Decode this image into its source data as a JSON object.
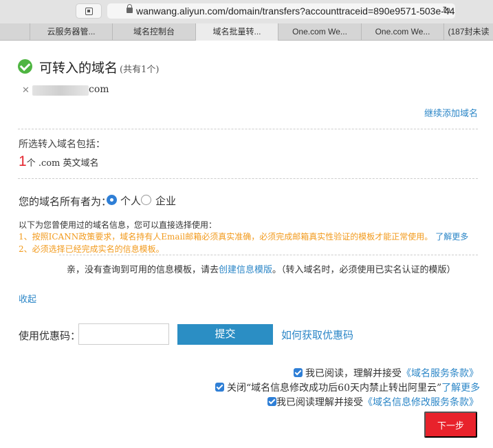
{
  "browser": {
    "url": "wanwang.aliyun.com/domain/transfers?accounttraceid=890e9571-503e-44",
    "tabs": [
      {
        "label": ""
      },
      {
        "label": "云服务器管..."
      },
      {
        "label": "域名控制台"
      },
      {
        "label": "域名批量转..."
      },
      {
        "label": "One.com We..."
      },
      {
        "label": "One.com We..."
      },
      {
        "label": "(187封未读"
      }
    ]
  },
  "section": {
    "title": "可转入的域名",
    "count_text": "(共有1个)",
    "domain_suffix": "com",
    "add_more": "继续添加域名"
  },
  "included": {
    "label": "所选转入域名包括：",
    "count": "1",
    "description": "个 .com 英文域名"
  },
  "owner": {
    "label": "您的域名所有者为：",
    "options": [
      {
        "label": "个人",
        "selected": true
      },
      {
        "label": "企业",
        "selected": false
      }
    ]
  },
  "info": {
    "intro": "以下为您曾使用过的域名信息，您可以直接选择使用：",
    "warning_1": "1、按照ICANN政策要求，域名持有人Email邮箱必须真实准确，必须完成邮箱真实性验证的模板才能正常使用。",
    "learn_more": "了解更多",
    "warning_2": "2、必须选择已经完成实名的信息模板。",
    "no_template_prefix": "亲，没有查询到可用的信息模板，请去",
    "create_template_link": "创建信息模版",
    "no_template_suffix": "。（转入域名时，必须使用已实名认证的模版）",
    "collapse": "收起"
  },
  "coupon": {
    "label": "使用优惠码：",
    "value": "",
    "submit": "提交",
    "help_link": "如何获取优惠码"
  },
  "agreements": {
    "agree1_prefix": "我已阅读，理解并接受",
    "agree1_link": "《域名服务条款》",
    "agree2_prefix": "关闭“域名信息修改成功后60天内禁止转出阿里云”",
    "agree2_link": "了解更多",
    "agree3_prefix": "我已阅读理解并接受",
    "agree3_link": "《域名信息修改服务条款》",
    "next": "下一步"
  },
  "colors": {
    "link": "#2b86c7",
    "warning": "#f29a1c",
    "primary_button": "#2b8ec4",
    "next_button": "#e8222b",
    "success_icon": "#4fb542"
  }
}
